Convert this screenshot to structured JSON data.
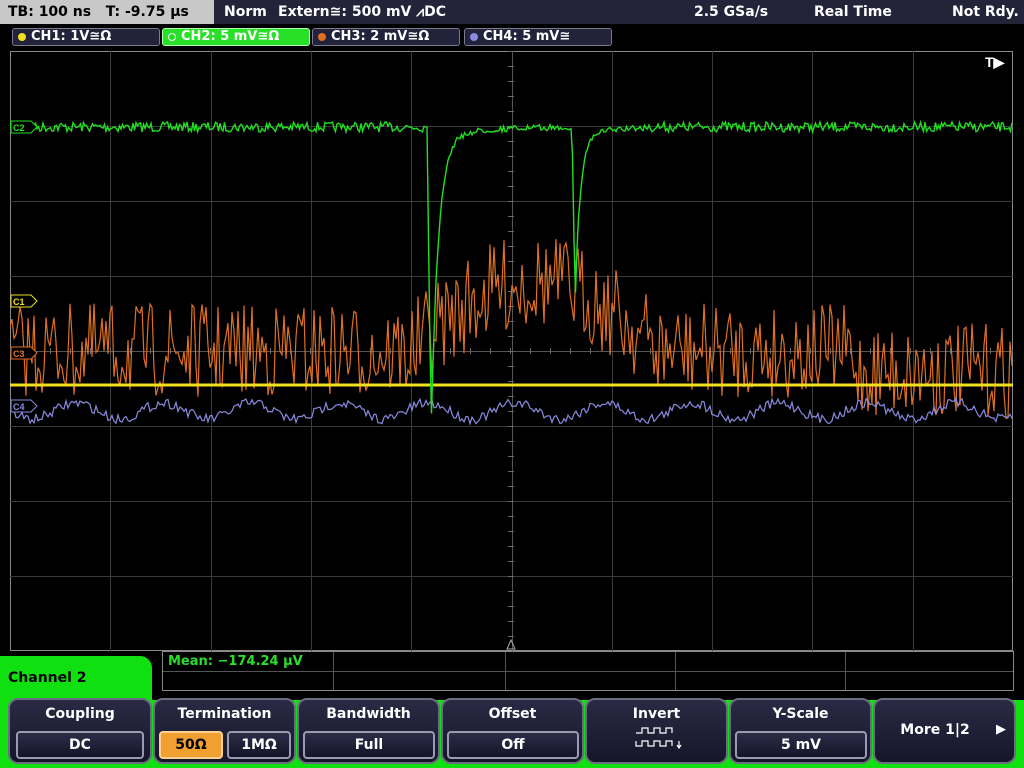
{
  "status": {
    "timebase": "TB: 100 ns",
    "trigger_time": "T: -9.75 µs",
    "trigger_mode": "Norm",
    "trigger_source": "Extern≅: 500 mV ⩘DC",
    "sample_rate": "2.5 GSa/s",
    "acq_mode": "Real Time",
    "state": "Not Rdy."
  },
  "channels": [
    {
      "label": "CH1: 1V≅Ω",
      "color": "#f0e020"
    },
    {
      "label": "CH2: 5 mV≅Ω",
      "color": "#20e020",
      "active": true
    },
    {
      "label": "CH3: 2 mV≅Ω",
      "color": "#e07020"
    },
    {
      "label": "CH4: 5 mV≅",
      "color": "#8a8ae0"
    }
  ],
  "markers": {
    "trigger": "T▶",
    "c1": "C1",
    "c2": "C2",
    "c3": "C3",
    "c4": "C4"
  },
  "measurement": {
    "mean": "Mean: −174.24 µV"
  },
  "menu": {
    "title": "Channel 2",
    "coupling": {
      "title": "Coupling",
      "value": "DC"
    },
    "termination": {
      "title": "Termination",
      "opt1": "50Ω",
      "opt2": "1MΩ"
    },
    "bandwidth": {
      "title": "Bandwidth",
      "value": "Full"
    },
    "offset": {
      "title": "Offset",
      "value": "Off"
    },
    "invert": {
      "title": "Invert"
    },
    "yscale": {
      "title": "Y-Scale",
      "value": "5 mV"
    },
    "more": {
      "label": "More 1|2"
    }
  },
  "colors": {
    "ch1": "#f0e020",
    "ch2": "#20e020",
    "ch3": "#e07020",
    "ch4": "#8a8ae0",
    "menu_accent": "#10e010"
  }
}
